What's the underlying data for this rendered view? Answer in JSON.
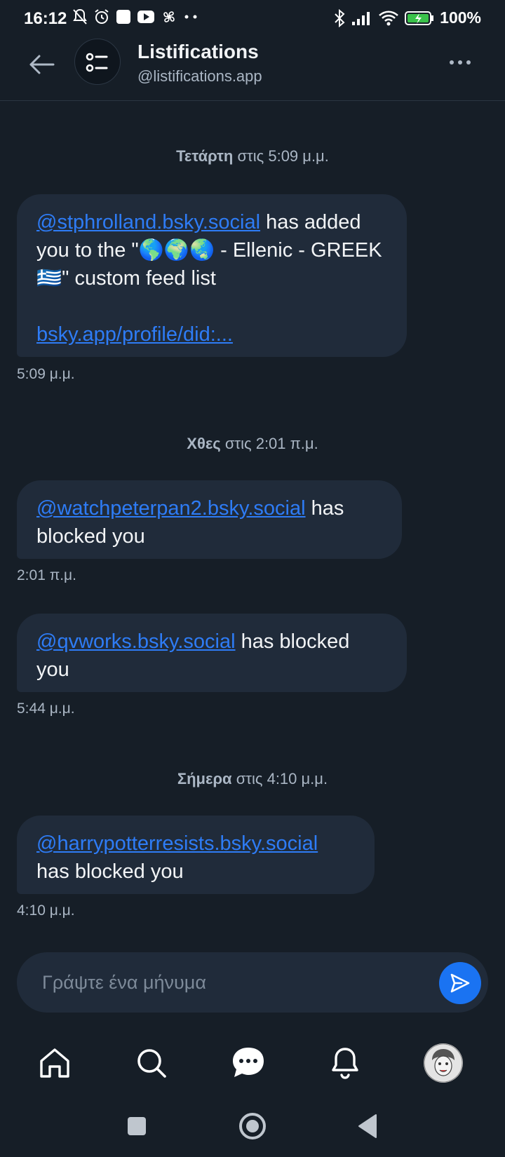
{
  "status_bar": {
    "time": "16:12",
    "battery": "100%"
  },
  "header": {
    "title": "Listifications",
    "handle": "@listifications.app"
  },
  "messages": [
    {
      "day_bold": "Τετάρτη",
      "day_rest": " στις 5:09 μ.μ.",
      "link": "@stphrolland.bsky.social",
      "text_after": " has added you to the \"🌎🌍🌏 - Ellenic - GREEK 🇬🇷\" custom feed list",
      "link2": "bsky.app/profile/did:...",
      "time": "5:09 μ.μ."
    },
    {
      "day_bold": "Χθες",
      "day_rest": " στις 2:01 π.μ.",
      "link": "@watchpeterpan2.bsky.social",
      "text_after": " has blocked you",
      "time": "2:01 π.μ."
    },
    {
      "link": "@qvworks.bsky.social",
      "text_after": " has blocked you",
      "time": "5:44 μ.μ."
    },
    {
      "day_bold": "Σήμερα",
      "day_rest": " στις 4:10 μ.μ.",
      "link": "@harrypotterresists.bsky.social",
      "text_after": " has blocked you",
      "time": "4:10 μ.μ."
    }
  ],
  "composer": {
    "placeholder": "Γράψτε ένα μήνυμα"
  },
  "tabs": [
    "home-icon",
    "search-icon",
    "chat-icon",
    "bell-icon",
    "profile-avatar"
  ],
  "colors": {
    "background": "#161e27",
    "bubble": "#202b3a",
    "link": "#2e7cf6",
    "accent": "#1a73f2"
  }
}
